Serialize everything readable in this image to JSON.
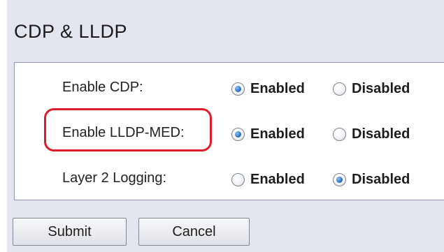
{
  "page": {
    "title": "CDP & LLDP"
  },
  "settings": [
    {
      "label": "Enable CDP:",
      "enabled_label": "Enabled",
      "disabled_label": "Disabled",
      "selected": "Enabled"
    },
    {
      "label": "Enable LLDP-MED:",
      "enabled_label": "Enabled",
      "disabled_label": "Disabled",
      "selected": "Enabled"
    },
    {
      "label": "Layer 2 Logging:",
      "enabled_label": "Enabled",
      "disabled_label": "Disabled",
      "selected": "Disabled"
    }
  ],
  "buttons": {
    "submit": "Submit",
    "cancel": "Cancel"
  },
  "colors": {
    "highlight": "#e01c2a",
    "panel_background": "#e3e6ee",
    "radio_selected": "#2d6fc2"
  }
}
